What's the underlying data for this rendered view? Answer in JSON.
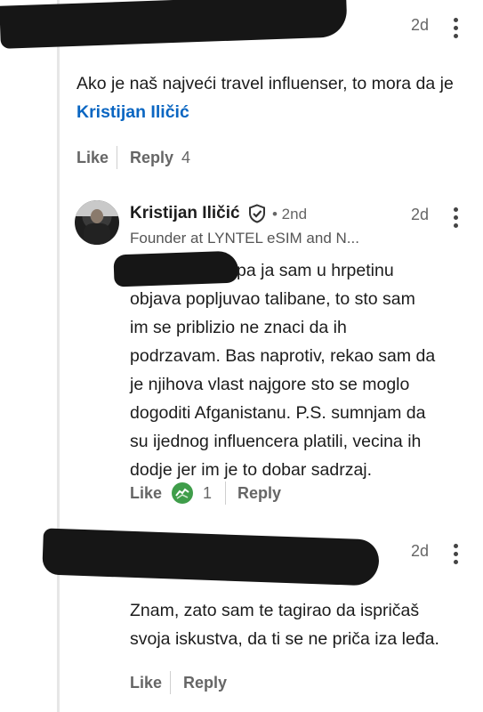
{
  "comment1": {
    "time": "2d",
    "text_prefix": "Ako je naš najveći travel influenser, to mora da je ",
    "mention": "Kristijan Iličić",
    "like": "Like",
    "reply": "Reply",
    "reply_count": "4"
  },
  "reply1": {
    "author": "Kristijan Iličić",
    "degree": "• 2nd",
    "headline": "Founder at LYNTEL eSIM and N...",
    "time": "2d",
    "lines": [
      "pa ja sam u hrpetinu",
      "objava popljuvao talibane, to sto sam",
      "im se priblizio ne znaci da ih",
      "podrzavam. Bas naprotiv, rekao sam da",
      "je njihova vlast najgore sto se moglo",
      "dogoditi Afganistanu. P.S. sumnjam da",
      "su ijednog influencera platili, vecina ih",
      "dodje jer im je to dobar sadrzaj."
    ],
    "like": "Like",
    "reaction_count": "1",
    "reply": "Reply",
    "reaction_icon": "support-reaction-icon",
    "reaction_color": "#3f9d4a"
  },
  "reply2": {
    "time": "2d",
    "lines": [
      "Znam, zato sam te tagirao da ispričaš",
      "svoja iskustva, da ti se ne priča iza leđa."
    ],
    "like": "Like",
    "reply": "Reply"
  },
  "colors": {
    "mention": "#0a66c2",
    "redaction": "#161616"
  }
}
